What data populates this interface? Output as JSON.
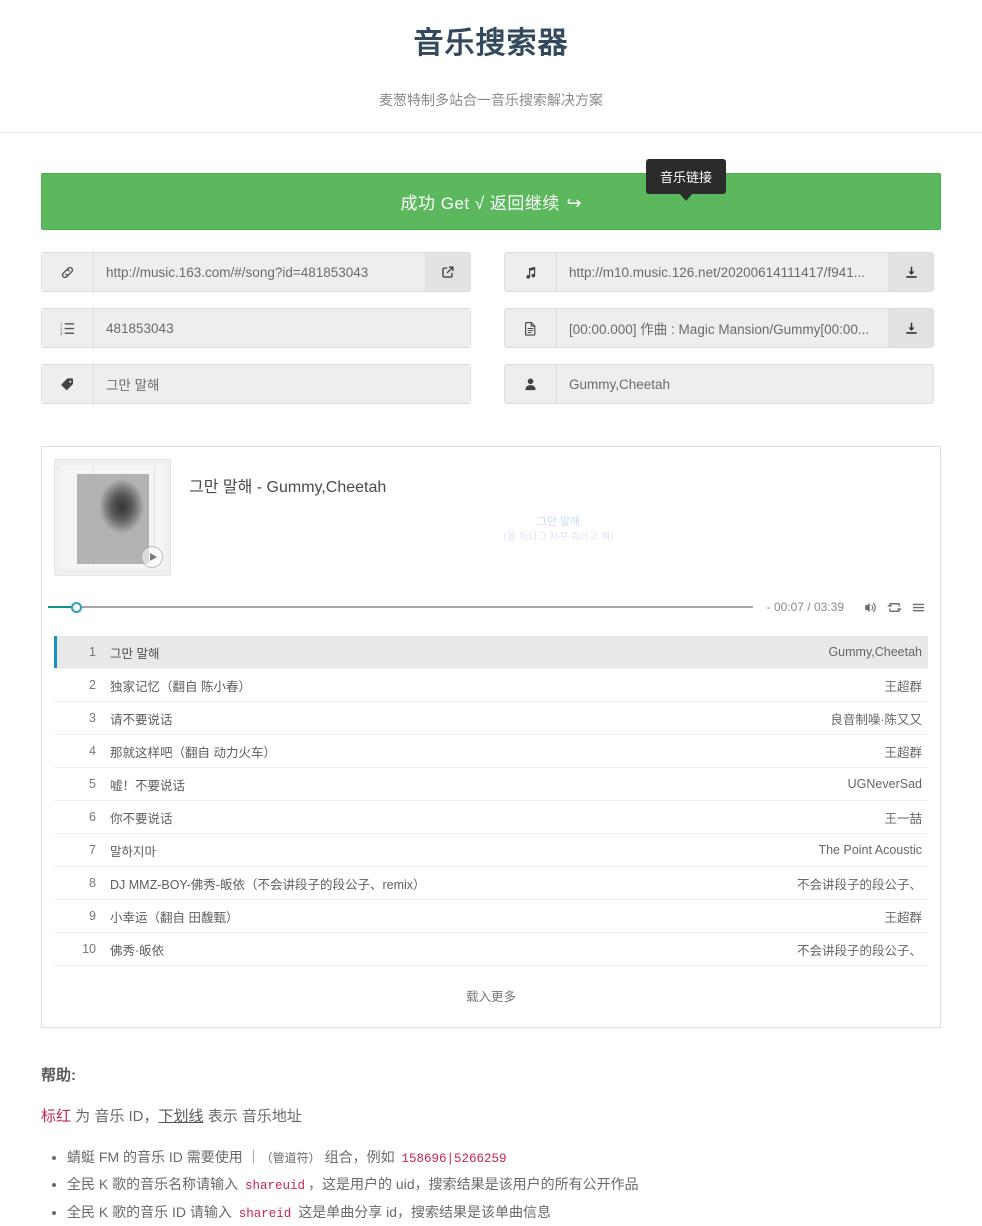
{
  "header": {
    "title": "音乐搜索器",
    "subtitle": "麦葱特制多站合一音乐搜索解决方案"
  },
  "banner": {
    "text": "成功 Get √ 返回继续",
    "arrow_glyph": "↩",
    "color": "#5cb85c"
  },
  "tooltip": {
    "label": "音乐链接"
  },
  "fields": {
    "left": [
      {
        "icon": "link-icon",
        "value": "http://music.163.com/#/song?id=481853043",
        "button": "external-link-icon"
      },
      {
        "icon": "ordered-list-icon",
        "value": "481853043",
        "button": null
      },
      {
        "icon": "tag-icon",
        "value": "그만 말해",
        "button": null
      }
    ],
    "right": [
      {
        "icon": "music-note-icon",
        "value": "http://m10.music.126.net/20200614111417/f941...",
        "button": "download-icon"
      },
      {
        "icon": "file-text-icon",
        "value": "[00:00.000] 作曲 : Magic Mansion/Gummy[00:00...",
        "button": "download-icon"
      },
      {
        "icon": "user-icon",
        "value": "Gummy,Cheetah",
        "button": null
      }
    ]
  },
  "player": {
    "track_title": "그만 말해 - Gummy,Cheetah",
    "lyric_current": "그만 말해",
    "lyric_next": "(을 하다그 자꾸 뭐라고 해)",
    "time": "- 00:07 / 03:39",
    "progress_percent": 4,
    "album_art_alt": "album-cover",
    "controls": {
      "volume": "volume-icon",
      "repeat": "repeat-icon",
      "menu": "playlist-menu-icon"
    }
  },
  "playlist": {
    "rows": [
      {
        "index": "1",
        "name": "그만 말해",
        "artist": "Gummy,Cheetah",
        "active": true
      },
      {
        "index": "2",
        "name": "独家记忆（翻自 陈小春）",
        "artist": "王超群",
        "active": false
      },
      {
        "index": "3",
        "name": "请不要说话",
        "artist": "良音制噪·陈又又",
        "active": false
      },
      {
        "index": "4",
        "name": "那就这样吧（翻自 动力火车）",
        "artist": "王超群",
        "active": false
      },
      {
        "index": "5",
        "name": "嘘！不要说话",
        "artist": "UGNeverSad",
        "active": false
      },
      {
        "index": "6",
        "name": "你不要说话",
        "artist": "王一喆",
        "active": false
      },
      {
        "index": "7",
        "name": "말하지마",
        "artist": "The Point Acoustic",
        "active": false
      },
      {
        "index": "8",
        "name": "DJ MMZ-BOY-佛秀-皈依（不会讲段子的段公子、remix）",
        "artist": "不会讲段子的段公子、",
        "active": false
      },
      {
        "index": "9",
        "name": "小幸运（翻自 田馥甄）",
        "artist": "王超群",
        "active": false
      },
      {
        "index": "10",
        "name": "佛秀·皈依",
        "artist": "不会讲段子的段公子、",
        "active": false
      }
    ],
    "load_more": "载入更多"
  },
  "help": {
    "title": "帮助:",
    "legend": {
      "red_word": "标红",
      "mid1": " 为 音乐 ID，",
      "underline_word": "下划线",
      "mid2": " 表示 音乐地址"
    },
    "items": [
      {
        "pre": "蜻蜓 FM 的音乐 ID 需要使用 ｜",
        "note": "（管道符）",
        "mid": " 组合，例如 ",
        "code": "158696|5266259",
        "post": ""
      },
      {
        "pre": "全民 K 歌的音乐名称请输入 ",
        "note": "",
        "mid": "",
        "code": "shareuid",
        "post": "，这是用户的 uid，搜索结果是该用户的所有公开作品"
      },
      {
        "pre": "全民 K 歌的音乐 ID 请输入 ",
        "note": "",
        "mid": "",
        "code": "shareid",
        "post": " 这是单曲分享 id，搜索结果是该单曲信息"
      }
    ]
  }
}
